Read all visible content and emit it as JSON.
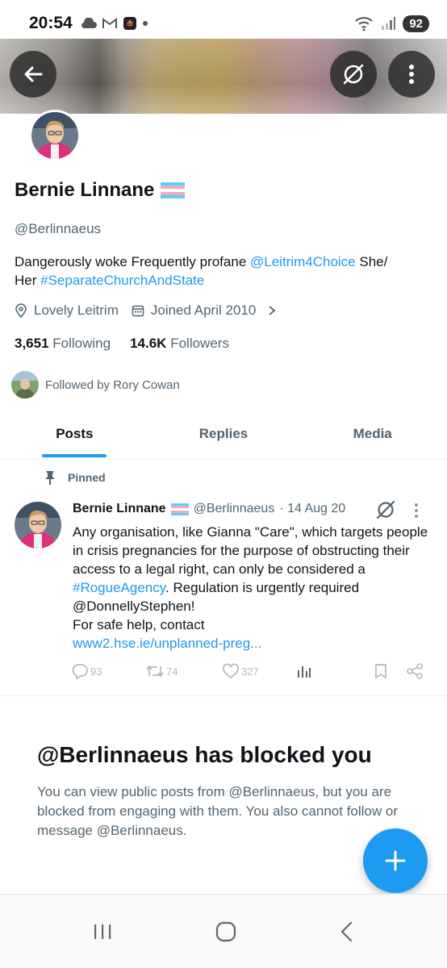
{
  "status_bar": {
    "time": "20:54",
    "battery": "92"
  },
  "profile": {
    "name": "Bernie Linnane",
    "handle": "@Berlinnaeus",
    "bio_prefix": "Dangerously woke  Frequently profane ",
    "bio_mention": "@Leitrim4Choice",
    "bio_middle": " She/",
    "bio_line2_prefix": "Her ",
    "bio_hashtag": "#SeparateChurchAndState",
    "location": "Lovely Leitrim",
    "joined": "Joined April 2010",
    "following_count": "3,651",
    "following_label": "Following",
    "followers_count": "14.6K",
    "followers_label": "Followers",
    "followed_by": "Followed by Rory Cowan"
  },
  "tabs": [
    {
      "label": "Posts",
      "active": true
    },
    {
      "label": "Replies",
      "active": false
    },
    {
      "label": "Media",
      "active": false
    }
  ],
  "post": {
    "pinned_label": "Pinned",
    "author": "Bernie Linnane",
    "handle": "@Berlinnaeus",
    "date": "· 14 Aug 20",
    "text_part1": "Any organisation, like Gianna \"Care\", which targets people in crisis pregnancies for the purpose of obstructing their access to a legal right, can only be considered a ",
    "hashtag": "#RogueAgency",
    "text_part2": ". Regulation is urgently required @DonnellyStephen!",
    "text_line3": "For safe help, contact",
    "link": "www2.hse.ie/unplanned-preg...",
    "replies": "93",
    "reposts": "74",
    "likes": "327"
  },
  "blocked": {
    "title": "@Berlinnaeus has blocked you",
    "message": "You can view public posts from @Berlinnaeus, but you are blocked from engaging with them. You also cannot follow or message @Berlinnaeus."
  },
  "colors": {
    "accent": "#1d9bf0",
    "text": "#0f1419",
    "secondary": "#536471"
  },
  "icons": [
    "back-arrow-icon",
    "grok-icon",
    "more-vertical-icon",
    "location-icon",
    "calendar-icon",
    "chevron-right-icon",
    "pin-icon",
    "reply-icon",
    "repost-icon",
    "like-icon",
    "views-icon",
    "bookmark-icon",
    "share-icon",
    "plus-icon",
    "recent-apps-icon",
    "home-icon",
    "back-icon",
    "trans-flag-icon"
  ]
}
